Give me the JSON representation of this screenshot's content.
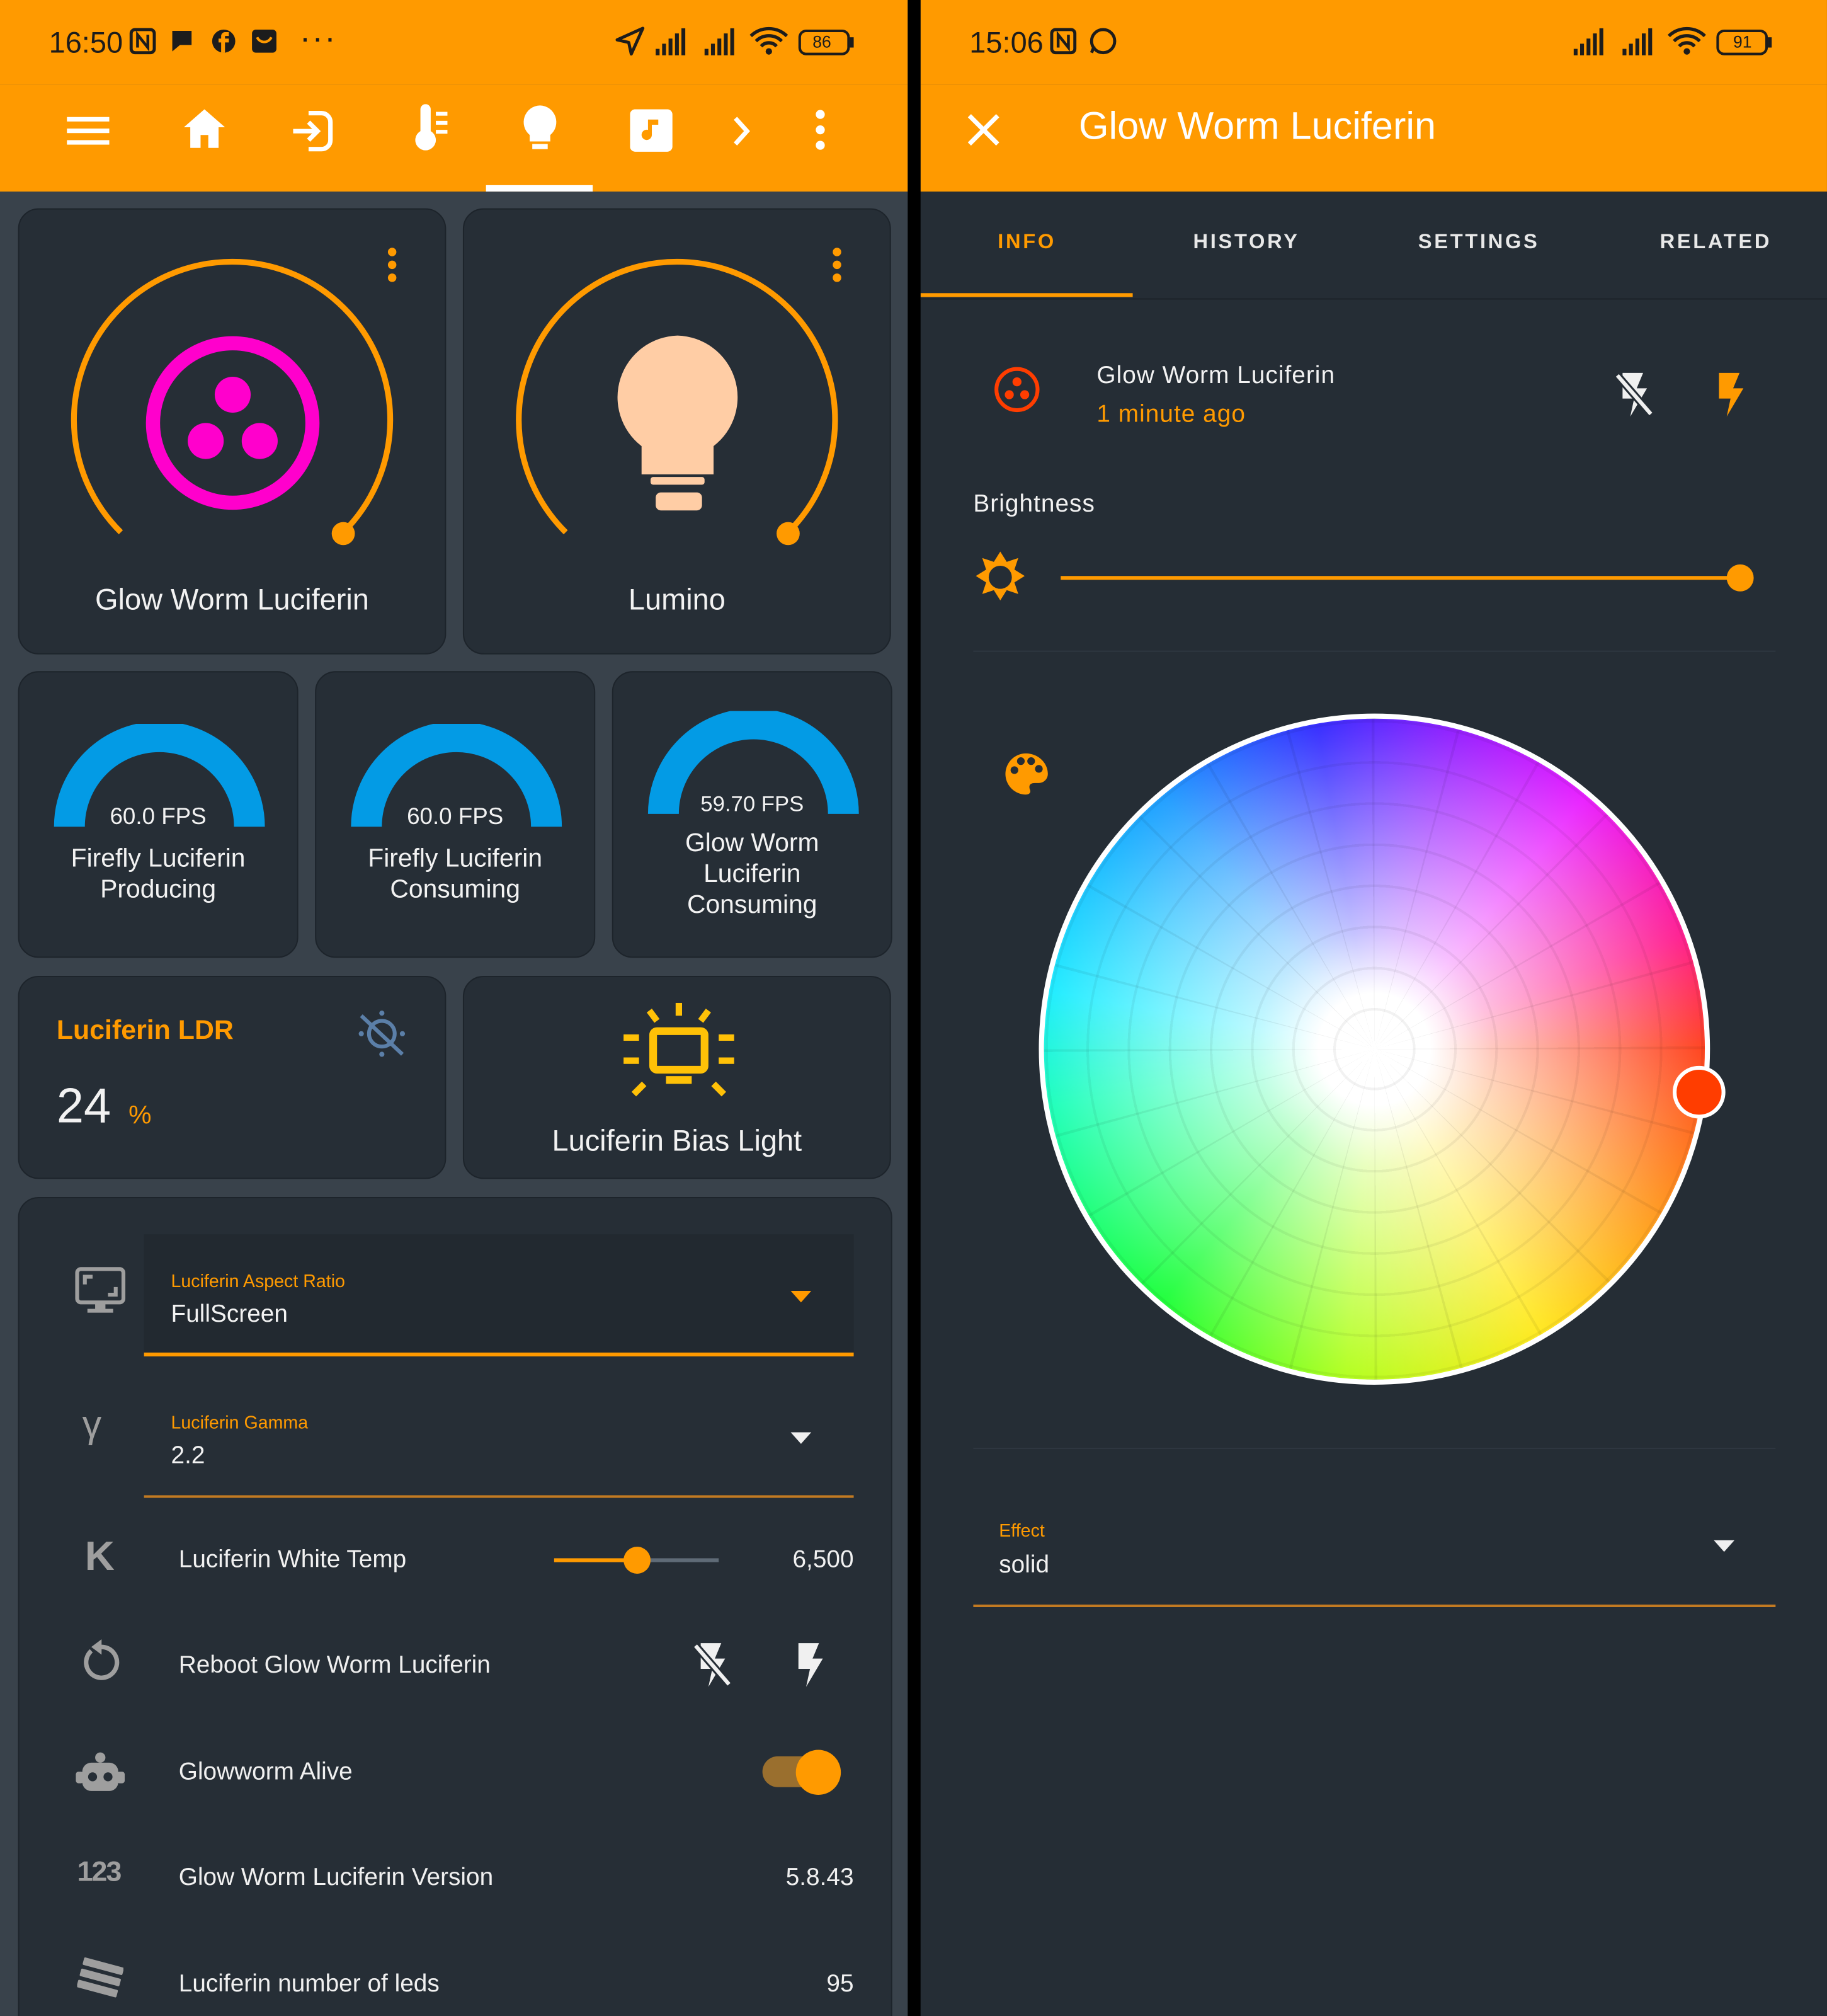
{
  "left": {
    "status": {
      "time": "16:50",
      "battery": "86",
      "more": "···"
    },
    "toolbar": {
      "icons": [
        "menu-icon",
        "home-icon",
        "login-icon",
        "thermometer-icon",
        "lightbulb-icon",
        "music-icon",
        "chevron-right-icon",
        "more-vert-icon"
      ],
      "active_tab": "lightbulb-icon"
    },
    "lights": [
      {
        "name": "Glow Worm Luciferin",
        "icon": "glowworm-icon",
        "color": "#ff00cc"
      },
      {
        "name": "Lumino",
        "icon": "lightbulb-icon",
        "color": "#ffcda5"
      }
    ],
    "gauges": [
      {
        "value": "60.0 FPS",
        "label": "Firefly Luciferin Producing",
        "fraction": 1.0
      },
      {
        "value": "60.0 FPS",
        "label": "Firefly Luciferin Consuming",
        "fraction": 1.0
      },
      {
        "value": "59.70 FPS",
        "label": "Glow Worm Luciferin Consuming",
        "fraction": 0.995
      }
    ],
    "ldr": {
      "title": "Luciferin LDR",
      "value": "24",
      "unit": "%"
    },
    "bias": {
      "label": "Luciferin Bias Light"
    },
    "entities": {
      "aspect": {
        "label": "Luciferin Aspect Ratio",
        "value": "FullScreen"
      },
      "gamma": {
        "label": "Luciferin Gamma",
        "value": "2.2"
      },
      "white_temp": {
        "label": "Luciferin White Temp",
        "value": "6,500",
        "slider_fraction": 0.5
      },
      "reboot": {
        "label": "Reboot Glow Worm Luciferin"
      },
      "alive": {
        "label": "Glowworm Alive",
        "state": true
      },
      "version": {
        "label": "Glow Worm Luciferin Version",
        "value": "5.8.43"
      },
      "leds": {
        "label": "Luciferin number of leds",
        "value": "95"
      }
    },
    "icon_text": {
      "gamma": "γ",
      "k": "K",
      "num": "123"
    }
  },
  "right": {
    "status": {
      "time": "15:06",
      "battery": "91"
    },
    "title": "Glow Worm Luciferin",
    "tabs": [
      "INFO",
      "HISTORY",
      "SETTINGS",
      "RELATED"
    ],
    "active_tab": "INFO",
    "entity": {
      "name": "Glow Worm Luciferin",
      "updated": "1 minute ago"
    },
    "brightness": {
      "label": "Brightness",
      "fraction": 1.0
    },
    "effect": {
      "label": "Effect",
      "value": "solid"
    },
    "accent": "#ff9a00",
    "selected_color": "#ff3d00"
  }
}
